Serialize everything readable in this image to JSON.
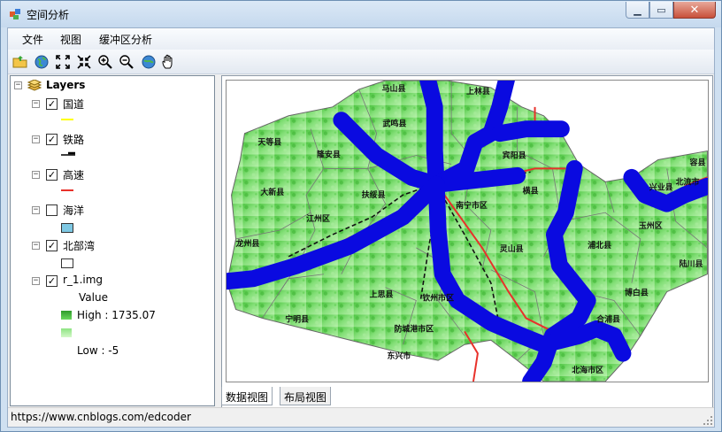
{
  "window": {
    "title": "空间分析"
  },
  "menu": [
    {
      "label": "文件"
    },
    {
      "label": "视图"
    },
    {
      "label": "缓冲区分析"
    }
  ],
  "toolbar": {
    "tools": [
      "open-folder-icon",
      "globe-icon",
      "full-extent-icon",
      "fixed-zoom-icon",
      "zoom-in-icon",
      "zoom-out-icon",
      "refresh-globe-icon",
      "pan-hand-icon"
    ]
  },
  "toc": {
    "root": "Layers",
    "layers": [
      {
        "name": "国道",
        "checked": true,
        "symbol": "line",
        "color": "#ffff00"
      },
      {
        "name": "铁路",
        "checked": true,
        "symbol": "railway",
        "color": "#000000"
      },
      {
        "name": "高速",
        "checked": true,
        "symbol": "line",
        "color": "#e8312a"
      },
      {
        "name": "海洋",
        "checked": false,
        "symbol": "fill",
        "color": "#7ec8e3"
      },
      {
        "name": "北部湾",
        "checked": true,
        "symbol": "fill",
        "color": "#ffffff"
      },
      {
        "name": "r_1.img",
        "checked": true,
        "symbol": "raster"
      }
    ],
    "raster_legend": {
      "value_label": "Value",
      "high_label": "High : 1735.07",
      "low_label": "Low : -5",
      "high_color": "#4cbf3f",
      "low_color": "#c6f5b8"
    }
  },
  "map": {
    "labels": [
      "马山县",
      "上林县",
      "武鸣县",
      "天等县",
      "隆安县",
      "宾阳县",
      "大新县",
      "扶绥县",
      "南宁市区",
      "横县",
      "兴业县",
      "北流市",
      "容县",
      "江州区",
      "龙州县",
      "灵山县",
      "浦北县",
      "玉州区",
      "陆川县",
      "上思县",
      "钦州市区",
      "博白县",
      "宁明县",
      "防城港市区",
      "合浦县",
      "东兴市",
      "北海市区"
    ],
    "buffer_color": "#0a0ae0",
    "highway_color": "#e8312a"
  },
  "tabs": [
    {
      "label": "数据视图",
      "active": true
    },
    {
      "label": "布局视图",
      "active": false
    }
  ],
  "status": {
    "text": "https://www.cnblogs.com/edcoder"
  }
}
